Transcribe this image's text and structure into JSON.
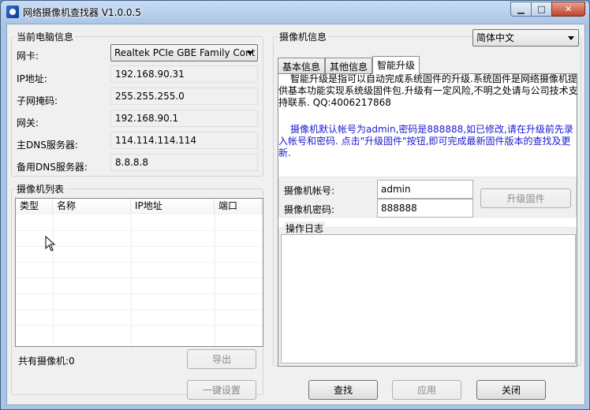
{
  "window": {
    "title": "网络摄像机查找器 V1.0.0.5",
    "controls": {
      "minimize": "▁",
      "maximize": "□",
      "close": "✕"
    }
  },
  "pc_info": {
    "legend": "当前电脑信息",
    "nic_label": "网卡:",
    "nic_value": "Realtek PCIe GBE Family Cont",
    "ip_label": "IP地址:",
    "ip_value": "192.168.90.31",
    "mask_label": "子网掩码:",
    "mask_value": "255.255.255.0",
    "gateway_label": "网关:",
    "gateway_value": "192.168.90.1",
    "dns1_label": "主DNS服务器:",
    "dns1_value": "114.114.114.114",
    "dns2_label": "备用DNS服务器:",
    "dns2_value": "8.8.8.8"
  },
  "camera_list": {
    "legend": "摄像机列表",
    "columns": [
      "类型",
      "名称",
      "IP地址",
      "端口"
    ],
    "total_label": "共有摄像机:0",
    "export_button": "导出"
  },
  "camera_info": {
    "legend": "摄像机信息",
    "language_value": "简体中文",
    "tabs": [
      "基本信息",
      "其他信息",
      "智能升级"
    ],
    "active_tab": 2,
    "upgrade_desc": "智能升级是指可以自动完成系统固件的升级.系统固件是网络摄像机提供基本功能实现系统级固件包.升级有一定风险,不明之处请与公司技术支持联系. QQ:4006217868",
    "default_account_desc": "摄像机默认帐号为admin,密码是888888,如已修改,请在升级前先录入帐号和密码. 点击\"升级固件\"按钮,即可完成最新固件版本的查找及更新.",
    "account_label": "摄像机帐号:",
    "account_value": "admin",
    "password_label": "摄像机密码:",
    "password_value": "888888",
    "upgrade_button": "升级固件",
    "log_legend": "操作日志"
  },
  "bottom_buttons": {
    "one_key_setup": "一键设置",
    "search": "查找",
    "apply": "应用",
    "close": "关闭"
  }
}
